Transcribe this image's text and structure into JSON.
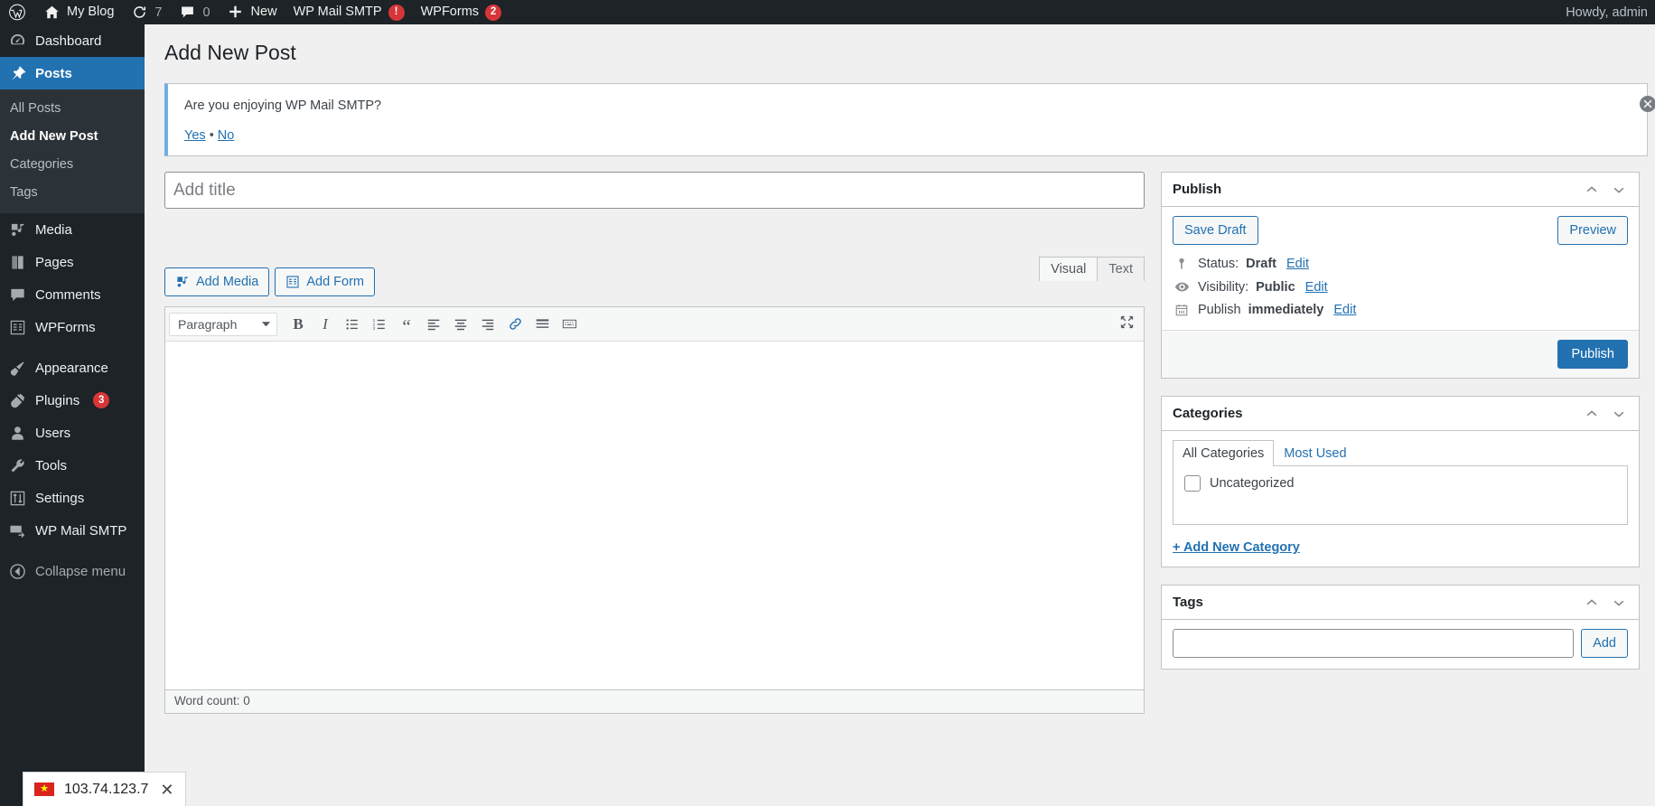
{
  "adminbar": {
    "logo_icon": "wordpress-logo-icon",
    "site_name": "My Blog",
    "updates": {
      "icon": "updates-icon",
      "count": "7"
    },
    "comments": {
      "icon": "comment-bubble-icon",
      "count": "0"
    },
    "new": {
      "icon": "plus-icon",
      "label": "New"
    },
    "wp_mail_smtp": {
      "label": "WP Mail SMTP",
      "badge": "!"
    },
    "wpforms": {
      "label": "WPForms",
      "badge": "2"
    },
    "howdy": "Howdy, admin"
  },
  "sidebar": {
    "items": [
      {
        "label": "Dashboard",
        "icon": "dashboard-icon",
        "current": false
      },
      {
        "label": "Posts",
        "icon": "pin-icon",
        "current": true
      },
      {
        "label": "Media",
        "icon": "media-icon",
        "current": false
      },
      {
        "label": "Pages",
        "icon": "pages-icon",
        "current": false
      },
      {
        "label": "Comments",
        "icon": "comment-bubble-icon",
        "current": false
      },
      {
        "label": "WPForms",
        "icon": "wpforms-icon",
        "current": false
      },
      {
        "label": "Appearance",
        "icon": "paintbrush-icon",
        "current": false
      },
      {
        "label": "Plugins",
        "icon": "plug-icon",
        "current": false,
        "badge": "3"
      },
      {
        "label": "Users",
        "icon": "user-icon",
        "current": false
      },
      {
        "label": "Tools",
        "icon": "wrench-icon",
        "current": false
      },
      {
        "label": "Settings",
        "icon": "sliders-icon",
        "current": false
      },
      {
        "label": "WP Mail SMTP",
        "icon": "envelope-arrow-icon",
        "current": false
      }
    ],
    "submenu": [
      {
        "label": "All Posts",
        "current": false
      },
      {
        "label": "Add New Post",
        "current": true
      },
      {
        "label": "Categories",
        "current": false
      },
      {
        "label": "Tags",
        "current": false
      }
    ],
    "collapse": {
      "label": "Collapse menu",
      "icon": "collapse-arrow-icon"
    }
  },
  "page": {
    "title": "Add New Post"
  },
  "notice": {
    "text": "Are you enjoying WP Mail SMTP?",
    "yes": "Yes",
    "separator": "•",
    "no": "No",
    "dismiss_icon": "close-circle-icon",
    "accent_color": "#72aee6"
  },
  "editor": {
    "title_placeholder": "Add title",
    "title_value": "",
    "add_media": "Add Media",
    "add_media_icon": "media-icon",
    "add_form": "Add Form",
    "add_form_icon": "form-icon",
    "tabs": [
      {
        "label": "Visual",
        "active": true
      },
      {
        "label": "Text",
        "active": false
      }
    ],
    "format_select": "Paragraph",
    "format_caret_icon": "chevron-down-icon",
    "toolbar_buttons": [
      {
        "name": "bold-icon",
        "glyph": "B"
      },
      {
        "name": "italic-icon",
        "glyph": "I"
      },
      {
        "name": "bulleted-list-icon",
        "glyph": ""
      },
      {
        "name": "numbered-list-icon",
        "glyph": ""
      },
      {
        "name": "blockquote-icon",
        "glyph": "“"
      },
      {
        "name": "align-left-icon",
        "glyph": ""
      },
      {
        "name": "align-center-icon",
        "glyph": ""
      },
      {
        "name": "align-right-icon",
        "glyph": ""
      },
      {
        "name": "link-icon",
        "glyph": ""
      },
      {
        "name": "read-more-icon",
        "glyph": ""
      },
      {
        "name": "toolbar-toggle-icon",
        "glyph": ""
      }
    ],
    "fullscreen_icon": "distraction-free-icon",
    "content": "",
    "word_count": "Word count: 0"
  },
  "publish_box": {
    "title": "Publish",
    "collapse_up_icon": "chevron-up-icon",
    "collapse_down_icon": "chevron-down-icon",
    "save_draft": "Save Draft",
    "preview": "Preview",
    "status_icon": "pin-status-icon",
    "status_label": "Status:",
    "status_value": "Draft",
    "status_edit": "Edit",
    "visibility_icon": "eye-icon",
    "visibility_label": "Visibility:",
    "visibility_value": "Public",
    "visibility_edit": "Edit",
    "schedule_icon": "calendar-icon",
    "schedule_label": "Publish",
    "schedule_value": "immediately",
    "schedule_edit": "Edit",
    "publish_button": "Publish"
  },
  "categories_box": {
    "title": "Categories",
    "tabs": [
      {
        "label": "All Categories",
        "active": true
      },
      {
        "label": "Most Used",
        "active": false
      }
    ],
    "items": [
      {
        "label": "Uncategorized",
        "checked": false
      }
    ],
    "add_new": "+ Add New Category"
  },
  "tags_box": {
    "title": "Tags",
    "input_value": "",
    "add_button": "Add"
  },
  "ip_overlay": {
    "flag_icon": "vietnam-flag-icon",
    "ip": "103.74.123.7",
    "close_icon": "close-icon"
  }
}
